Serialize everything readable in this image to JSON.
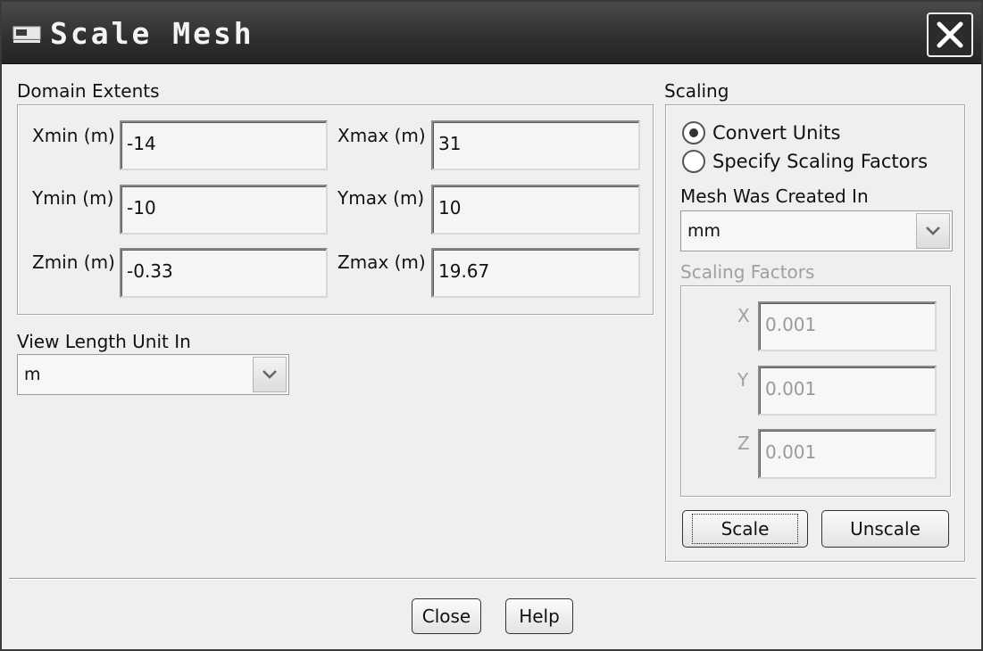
{
  "window": {
    "title": "Scale Mesh"
  },
  "domain_extents": {
    "label": "Domain Extents",
    "xmin": {
      "label": "Xmin (m)",
      "value": "-14"
    },
    "xmax": {
      "label": "Xmax (m)",
      "value": "31"
    },
    "ymin": {
      "label": "Ymin (m)",
      "value": "-10"
    },
    "ymax": {
      "label": "Ymax (m)",
      "value": "10"
    },
    "zmin": {
      "label": "Zmin (m)",
      "value": "-0.33"
    },
    "zmax": {
      "label": "Zmax (m)",
      "value": "19.67"
    }
  },
  "view_length_unit": {
    "label": "View Length Unit In",
    "value": "m"
  },
  "scaling": {
    "label": "Scaling",
    "options": [
      {
        "label": "Convert Units",
        "selected": true
      },
      {
        "label": "Specify Scaling Factors",
        "selected": false
      }
    ],
    "mesh_created_in": {
      "label": "Mesh Was Created In",
      "value": "mm"
    },
    "factors": {
      "label": "Scaling Factors",
      "x": {
        "label": "X",
        "value": "0.001"
      },
      "y": {
        "label": "Y",
        "value": "0.001"
      },
      "z": {
        "label": "Z",
        "value": "0.001"
      }
    },
    "scale_button": "Scale",
    "unscale_button": "Unscale"
  },
  "footer": {
    "close_button": "Close",
    "help_button": "Help"
  },
  "icons": {
    "window_icon": "window-icon",
    "close": "close-icon",
    "dropdown": "chevron-down-icon"
  }
}
